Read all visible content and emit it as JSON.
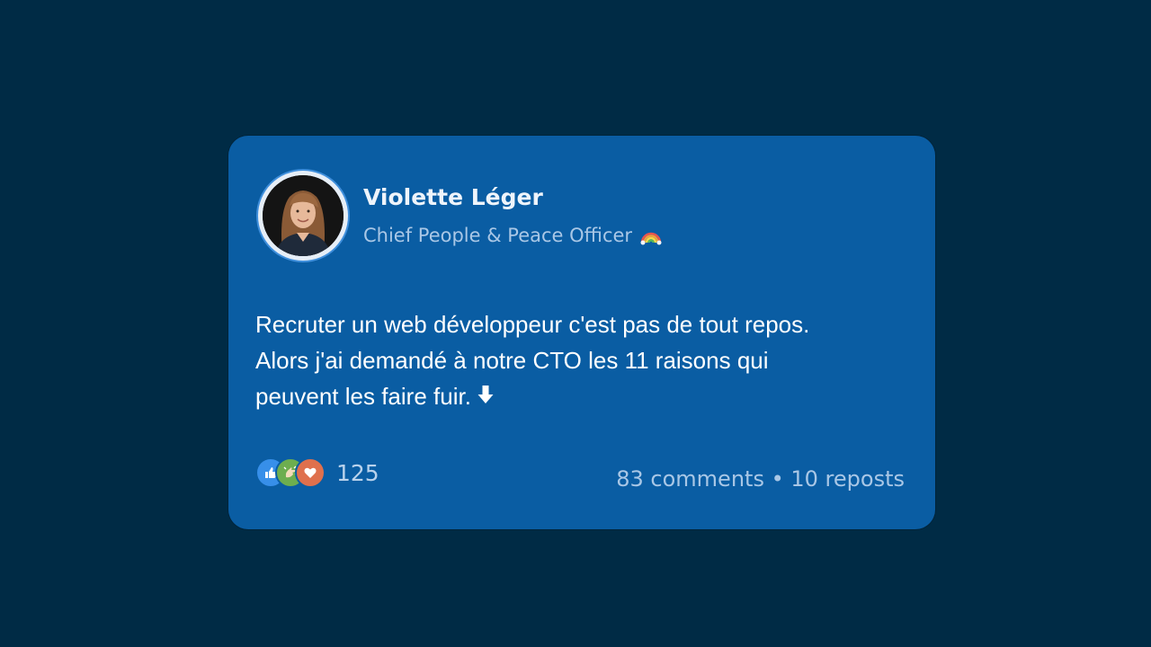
{
  "post": {
    "author": {
      "name": "Violette Léger",
      "title": "Chief People & Peace Officer"
    },
    "body_lines": [
      "Recruter un web développeur c'est pas de tout repos.",
      "Alors j'ai demandé à notre CTO les 11 raisons qui",
      "peuvent les faire fuir."
    ],
    "reactions": {
      "types": [
        "like",
        "celebrate",
        "love"
      ],
      "count": "125"
    },
    "stats": {
      "comments": "83 comments",
      "separator": "•",
      "reposts": "10 reposts"
    }
  },
  "colors": {
    "background": "#002b45",
    "card": "#0a5da3",
    "name": "#eef4fb",
    "subtitle": "#a9c7e6",
    "body_text": "#ffffff"
  },
  "icons": {
    "title_emoji": "rainbow-icon",
    "body_emoji": "down-arrow-icon"
  }
}
